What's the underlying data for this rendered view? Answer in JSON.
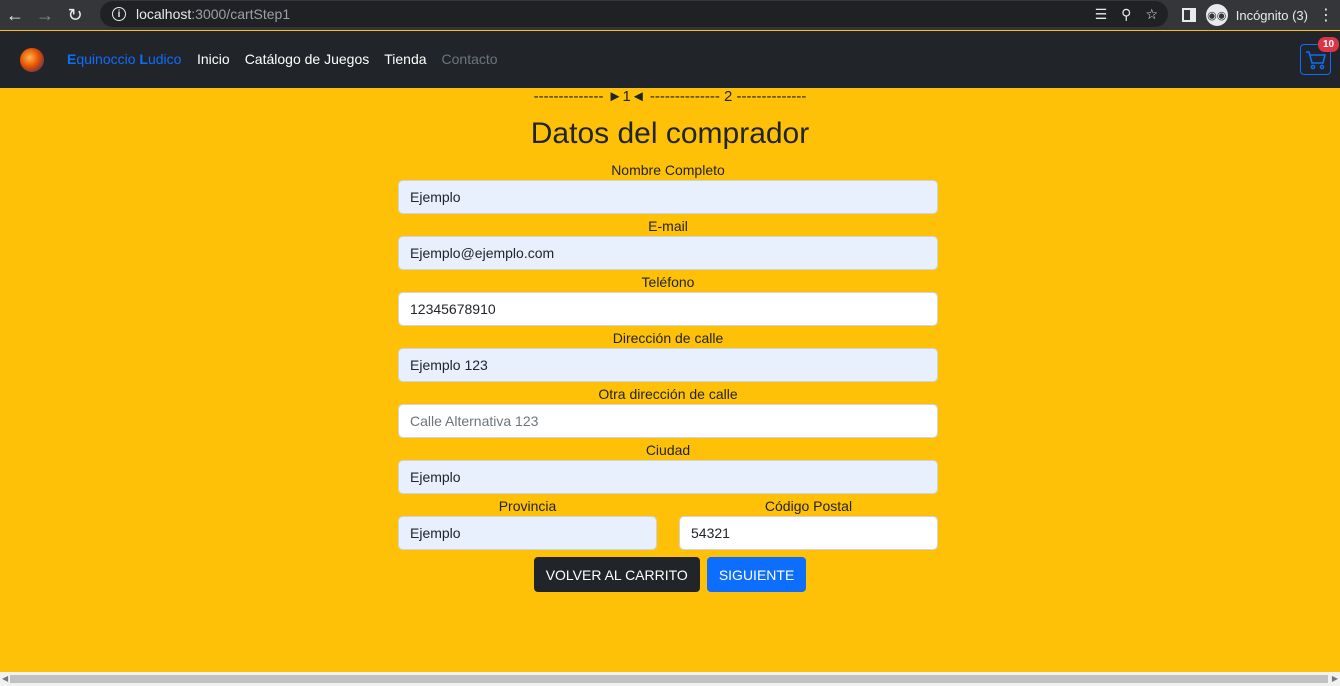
{
  "browser": {
    "url_host": "localhost",
    "url_path": ":3000/cartStep1",
    "profile_label": "Incógnito (3)"
  },
  "navbar": {
    "brand_first": "E",
    "brand_mid": "quinoccio ",
    "brand_second": "L",
    "brand_rest": "udico",
    "links": [
      "Inicio",
      "Catálogo de Juegos",
      "Tienda",
      "Contacto"
    ],
    "cart_count": "10"
  },
  "stepper": "-------------- ►1◄ -------------- 2 --------------",
  "page_title": "Datos del comprador",
  "form": {
    "nombre": {
      "label": "Nombre Completo",
      "value": "Ejemplo"
    },
    "email": {
      "label": "E-mail",
      "value": "Ejemplo@ejemplo.com"
    },
    "telefono": {
      "label": "Teléfono",
      "value": "12345678910"
    },
    "direccion": {
      "label": "Dirección de calle",
      "value": "Ejemplo 123"
    },
    "direccion2": {
      "label": "Otra dirección de calle",
      "placeholder": "Calle Alternativa 123"
    },
    "ciudad": {
      "label": "Ciudad",
      "value": "Ejemplo"
    },
    "provincia": {
      "label": "Provincia",
      "value": "Ejemplo"
    },
    "codigo_postal": {
      "label": "Código Postal",
      "value": "54321"
    }
  },
  "buttons": {
    "back": "VOLVER AL CARRITO",
    "next": "SIGUIENTE"
  },
  "colors": {
    "background": "#ffc107",
    "navbar": "#212529",
    "primary": "#0d6efd",
    "badge": "#dc3545"
  }
}
